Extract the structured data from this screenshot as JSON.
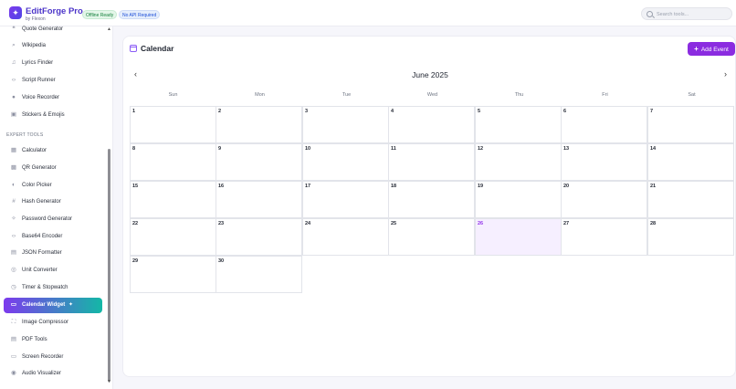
{
  "app": {
    "name": "EditForge Pro",
    "byline": "by Flexon",
    "logo_icon": "sparkle-icon",
    "badges": [
      "Offline Ready",
      "No API Required"
    ]
  },
  "search": {
    "placeholder": "Search tools..."
  },
  "sidebar": {
    "items_top": [
      {
        "label": "Quote Generator",
        "icon": "quote-icon"
      },
      {
        "label": "Wikipedia",
        "icon": "search-icon"
      },
      {
        "label": "Lyrics Finder",
        "icon": "music-icon"
      },
      {
        "label": "Script Runner",
        "icon": "code-icon"
      },
      {
        "label": "Voice Recorder",
        "icon": "mic-icon"
      },
      {
        "label": "Stickers & Emojis",
        "icon": "sticker-icon"
      }
    ],
    "section_expert": "EXPERT TOOLS",
    "items_expert": [
      {
        "label": "Calculator",
        "icon": "calculator-icon"
      },
      {
        "label": "QR Generator",
        "icon": "qr-icon"
      },
      {
        "label": "Color Picker",
        "icon": "palette-icon"
      },
      {
        "label": "Hash Generator",
        "icon": "hash-icon"
      },
      {
        "label": "Password Generator",
        "icon": "key-icon"
      },
      {
        "label": "Base64 Encoder",
        "icon": "code-icon"
      },
      {
        "label": "JSON Formatter",
        "icon": "file-icon"
      },
      {
        "label": "Unit Converter",
        "icon": "convert-icon"
      },
      {
        "label": "Timer & Stopwatch",
        "icon": "clock-icon"
      },
      {
        "label": "Calendar Widget",
        "icon": "calendar-icon",
        "active": true
      },
      {
        "label": "Image Compressor",
        "icon": "compress-icon"
      },
      {
        "label": "PDF Tools",
        "icon": "pdf-icon"
      },
      {
        "label": "Screen Recorder",
        "icon": "screen-icon"
      },
      {
        "label": "Audio Visualizer",
        "icon": "audio-icon"
      }
    ]
  },
  "calendar": {
    "title": "Calendar",
    "add_button": "Add Event",
    "month_label": "June 2025",
    "weekdays": [
      "Sun",
      "Mon",
      "Tue",
      "Wed",
      "Thu",
      "Fri",
      "Sat"
    ],
    "days": [
      "1",
      "2",
      "3",
      "4",
      "5",
      "6",
      "7",
      "8",
      "9",
      "10",
      "11",
      "12",
      "13",
      "14",
      "15",
      "16",
      "17",
      "18",
      "19",
      "20",
      "21",
      "22",
      "23",
      "24",
      "25",
      "26",
      "27",
      "28",
      "29",
      "30"
    ],
    "today": "26",
    "accent": "#8b2ce0"
  }
}
